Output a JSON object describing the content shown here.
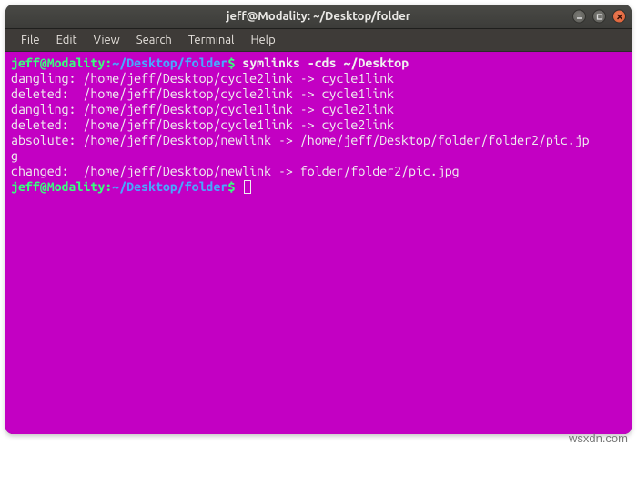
{
  "window": {
    "title": "jeff@Modality: ~/Desktop/folder"
  },
  "menubar": {
    "items": [
      "File",
      "Edit",
      "View",
      "Search",
      "Terminal",
      "Help"
    ]
  },
  "prompt": {
    "user_host": "jeff@Modality",
    "sep": ":",
    "path": "~/Desktop/folder",
    "symbol": "$"
  },
  "command": "symlinks -cds ~/Desktop",
  "output": [
    "dangling: /home/jeff/Desktop/cycle2link -> cycle1link",
    "deleted:  /home/jeff/Desktop/cycle2link -> cycle1link",
    "dangling: /home/jeff/Desktop/cycle1link -> cycle2link",
    "deleted:  /home/jeff/Desktop/cycle1link -> cycle2link",
    "absolute: /home/jeff/Desktop/newlink -> /home/jeff/Desktop/folder/folder2/pic.jp",
    "g",
    "changed:  /home/jeff/Desktop/newlink -> folder/folder2/pic.jpg"
  ],
  "watermark": "wsxdn.com"
}
